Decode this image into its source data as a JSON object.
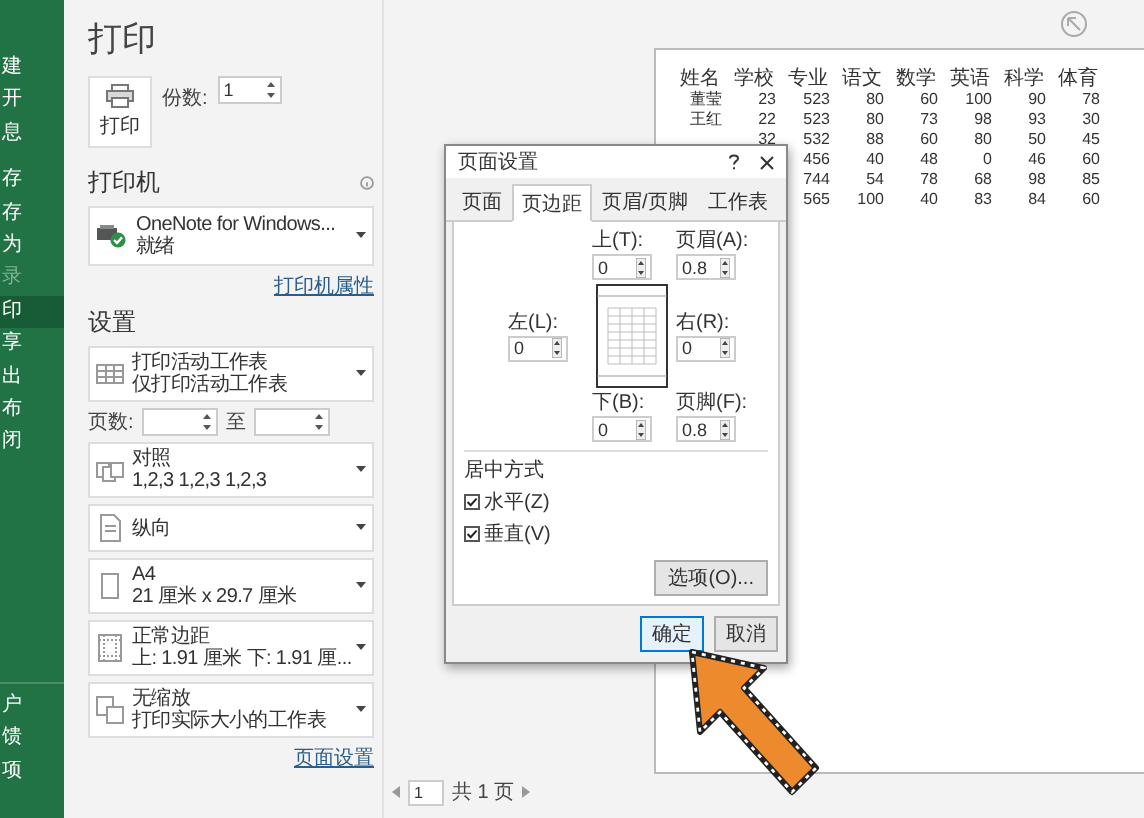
{
  "sidebar": {
    "items": [
      {
        "label": "建",
        "selected": false,
        "disabled": false
      },
      {
        "label": "开",
        "selected": false,
        "disabled": false
      },
      {
        "label": "息",
        "selected": false,
        "disabled": false
      },
      {
        "label": "存",
        "selected": false,
        "disabled": false
      },
      {
        "label": "存",
        "selected": false,
        "disabled": false
      },
      {
        "label": "为",
        "selected": false,
        "disabled": false
      },
      {
        "label": "录",
        "selected": false,
        "disabled": true
      },
      {
        "label": "印",
        "selected": true,
        "disabled": false
      },
      {
        "label": "享",
        "selected": false,
        "disabled": false
      },
      {
        "label": "出",
        "selected": false,
        "disabled": false
      },
      {
        "label": "布",
        "selected": false,
        "disabled": false
      },
      {
        "label": "闭",
        "selected": false,
        "disabled": false
      }
    ],
    "bottom_items": [
      {
        "label": "户",
        "selected": false,
        "disabled": false
      },
      {
        "label": "馈",
        "selected": false,
        "disabled": false
      },
      {
        "label": "项",
        "selected": false,
        "disabled": false
      }
    ]
  },
  "title": "打印",
  "print_button": {
    "label": "打印"
  },
  "copies": {
    "label": "份数:",
    "value": "1"
  },
  "printer": {
    "heading": "打印机",
    "name": "OneNote for Windows...",
    "status": "就绪",
    "properties_link": "打印机属性"
  },
  "settings": {
    "heading": "设置",
    "options": [
      {
        "kind": "sheets",
        "title": "打印活动工作表",
        "subtitle": "仅打印活动工作表"
      },
      {
        "kind": "pages",
        "label": "页数:",
        "to_label": "至"
      },
      {
        "kind": "collate",
        "title": "对照",
        "subtitle": "1,2,3    1,2,3    1,2,3"
      },
      {
        "kind": "orientation",
        "title": "纵向"
      },
      {
        "kind": "paper",
        "title": "A4",
        "subtitle": "21 厘米 x 29.7 厘米"
      },
      {
        "kind": "margins",
        "title": "正常边距",
        "subtitle": "上: 1.91 厘米 下: 1.91 厘..."
      },
      {
        "kind": "scaling",
        "title": "无缩放",
        "subtitle": "打印实际大小的工作表"
      }
    ],
    "page_setup_link": "页面设置"
  },
  "preview": {
    "columns": [
      "姓名",
      "学校",
      "专业",
      "语文",
      "数学",
      "英语",
      "科学",
      "体育"
    ],
    "rows": [
      {
        "cells": [
          "董莹",
          "23",
          "523",
          "80",
          "60",
          "100",
          "90",
          "78"
        ]
      },
      {
        "cells": [
          "王红",
          "22",
          "523",
          "80",
          "73",
          "98",
          "93",
          "30"
        ]
      },
      {
        "cells": [
          "",
          "32",
          "532",
          "88",
          "60",
          "80",
          "50",
          "45"
        ]
      },
      {
        "cells": [
          "",
          "",
          "456",
          "40",
          "48",
          "0",
          "46",
          "60"
        ]
      },
      {
        "cells": [
          "",
          "",
          "744",
          "54",
          "78",
          "68",
          "98",
          "85"
        ]
      },
      {
        "cells": [
          "",
          "",
          "565",
          "100",
          "40",
          "83",
          "84",
          "60"
        ]
      }
    ]
  },
  "pager": {
    "page": "1",
    "total": "共 1 页"
  },
  "dialog": {
    "title": "页面设置",
    "tabs": [
      {
        "label": "页面",
        "selected": false
      },
      {
        "label": "页边距",
        "selected": true
      },
      {
        "label": "页眉/页脚",
        "selected": false
      },
      {
        "label": "工作表",
        "selected": false
      }
    ],
    "fields": {
      "top": {
        "label": "上(T):",
        "value": "0"
      },
      "header": {
        "label": "页眉(A):",
        "value": "0.8"
      },
      "left": {
        "label": "左(L):",
        "value": "0"
      },
      "right": {
        "label": "右(R):",
        "value": "0"
      },
      "bottom": {
        "label": "下(B):",
        "value": "0"
      },
      "footer": {
        "label": "页脚(F):",
        "value": "0.8"
      }
    },
    "center": {
      "heading": "居中方式",
      "options": [
        {
          "label": "水平(Z)",
          "checked": true
        },
        {
          "label": "垂直(V)",
          "checked": true
        }
      ]
    },
    "options_button": "选项(O)...",
    "buttons": [
      {
        "label": "确定",
        "default": true
      },
      {
        "label": "取消",
        "default": false
      }
    ]
  }
}
